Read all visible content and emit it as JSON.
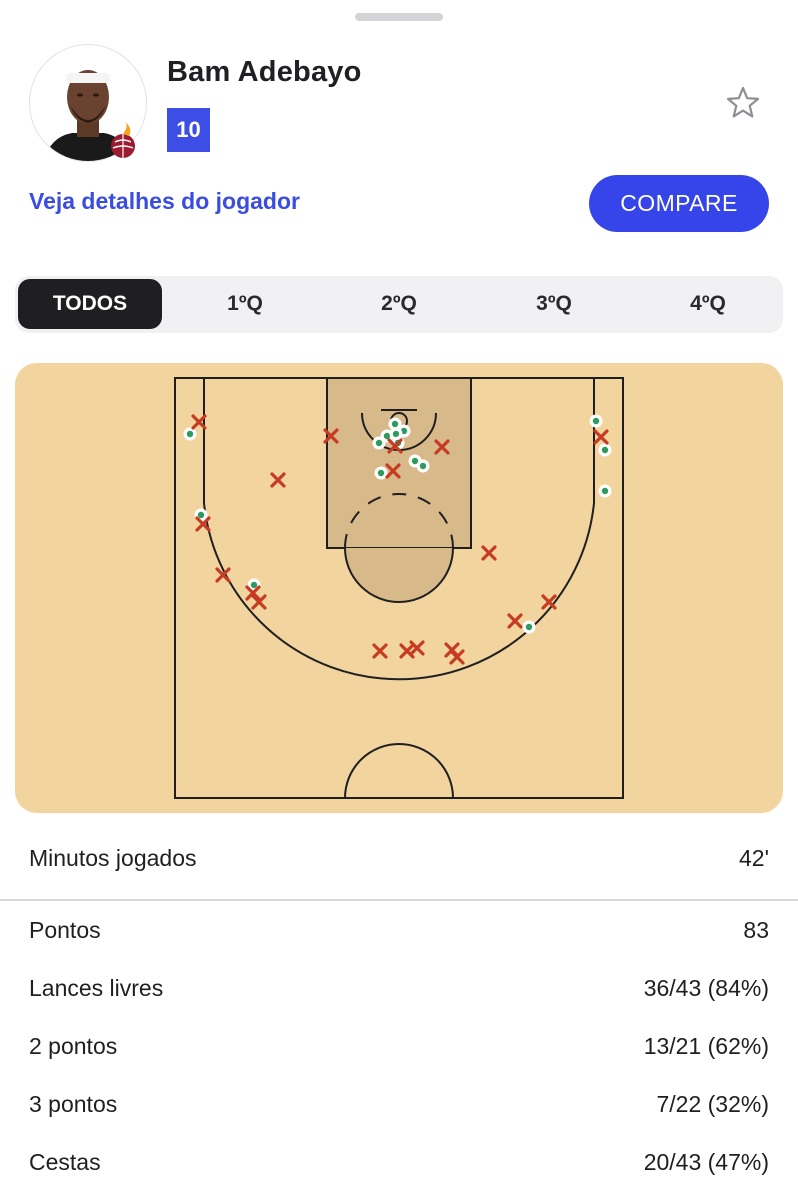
{
  "player": {
    "name": "Bam Adebayo",
    "number": "10",
    "team_logo": "miami-heat-logo"
  },
  "actions": {
    "details_link": "Veja detalhes do jogador",
    "compare_button": "COMPARE",
    "favorite_icon": "star-outline-icon"
  },
  "tabs": [
    {
      "label": "TODOS",
      "active": true
    },
    {
      "label": "1ºQ",
      "active": false
    },
    {
      "label": "2ºQ",
      "active": false
    },
    {
      "label": "3ºQ",
      "active": false
    },
    {
      "label": "4ºQ",
      "active": false
    }
  ],
  "colors": {
    "accent": "#3545ea",
    "court": "#f2d49f",
    "paint": "#d8b98a",
    "made_shot": "#2e9a5e",
    "missed_shot": "#c63b22"
  },
  "shot_chart": {
    "legend": {
      "made": "green dot inside white circle",
      "missed": "red x"
    }
  },
  "stats": {
    "minutes": {
      "label": "Minutos jogados",
      "value": "42'"
    },
    "points": {
      "label": "Pontos",
      "value": "83"
    },
    "free_throws": {
      "label": "Lances livres",
      "value": "36/43 (84%)"
    },
    "two_pointers": {
      "label": "2 pontos",
      "value": "13/21 (62%)"
    },
    "three_pointers": {
      "label": "3 pontos",
      "value": "7/22 (32%)"
    },
    "field_goals": {
      "label": "Cestas",
      "value": "20/43 (47%)"
    }
  }
}
